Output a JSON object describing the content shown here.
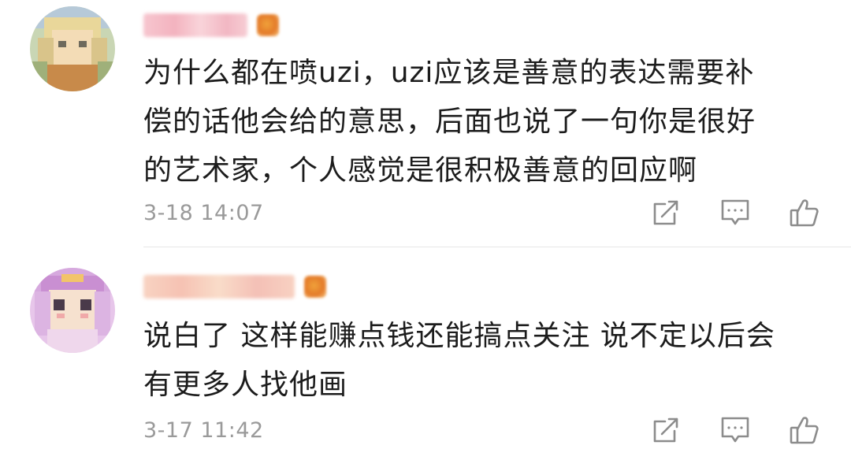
{
  "comments": [
    {
      "avatar_icon": "user-avatar-blurred",
      "username_icon": "blurred-username",
      "badge_icon": "vip-badge-icon",
      "text_lines": [
        "为什么都在喷uzi，uzi应该是善意的表达需要补",
        "偿的话他会给的意思，后面也说了一句你是很好",
        "的艺术家，个人感觉是很积极善意的回应啊"
      ],
      "time": "3-18 14:07",
      "actions": [
        "share-icon",
        "comment-icon",
        "like-icon"
      ]
    },
    {
      "avatar_icon": "user-avatar-blurred",
      "username_icon": "blurred-username",
      "badge_icon": "vip-badge-icon",
      "text_lines": [
        "说白了 这样能赚点钱还能搞点关注 说不定以后会",
        "有更多人找他画"
      ],
      "time": "3-17 11:42",
      "actions": [
        "share-icon",
        "comment-icon",
        "like-icon"
      ]
    }
  ],
  "colors": {
    "text": "#1c1c1c",
    "meta": "#9a9a9a",
    "icon": "#8c8c8c",
    "divider": "#e6e6e6"
  }
}
